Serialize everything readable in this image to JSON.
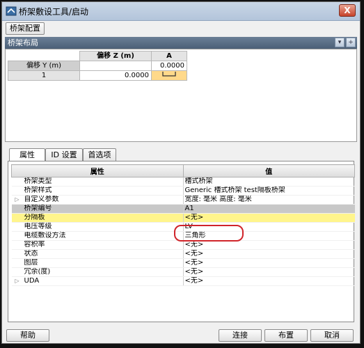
{
  "window": {
    "title": "桥架敷设工具/启动",
    "close_label": "X"
  },
  "toolbar": {
    "config_button": "桥架配置"
  },
  "layout_section": {
    "title": "桥架布局",
    "grid": {
      "col_header_z": "偏移 Z (m)",
      "col_header_a": "A",
      "row_header_y": "偏移 Y (m)",
      "row_y_value_a": "0.0000",
      "row1_label": "1",
      "row1_z": "0.0000"
    }
  },
  "tabs": [
    "属性",
    "ID 设置",
    "首选项"
  ],
  "properties": {
    "headers": {
      "name": "属性",
      "value": "值"
    },
    "rows": [
      {
        "expand": "",
        "name": "桥架类型",
        "value": "槽式桥架"
      },
      {
        "expand": "",
        "name": "桥架样式",
        "value": "Generic 槽式桥架 test隔板桥架"
      },
      {
        "expand": "▷",
        "name": "自定义参数",
        "value": "宽度: 毫米 高度: 毫米"
      },
      {
        "expand": "",
        "name": "桥架编号",
        "value": "A1"
      },
      {
        "expand": "",
        "name": "分隔板",
        "value": "<无>"
      },
      {
        "expand": "",
        "name": "电压等级",
        "value": "LV"
      },
      {
        "expand": "",
        "name": "电缆敷设方法",
        "value": "三角形"
      },
      {
        "expand": "",
        "name": "容积率",
        "value": "<无>"
      },
      {
        "expand": "",
        "name": "状态",
        "value": "<无>"
      },
      {
        "expand": "",
        "name": "图层",
        "value": "<无>"
      },
      {
        "expand": "",
        "name": "冗余(度)",
        "value": "<无>"
      },
      {
        "expand": "▷",
        "name": "UDA",
        "value": "<无>"
      }
    ]
  },
  "footer": {
    "help": "帮助",
    "connect": "连接",
    "layout": "布置",
    "cancel": "取消"
  },
  "colors": {
    "highlight_row": "#c8c8c8",
    "selected_row": "#fff58c",
    "annotation": "#d0242a"
  }
}
